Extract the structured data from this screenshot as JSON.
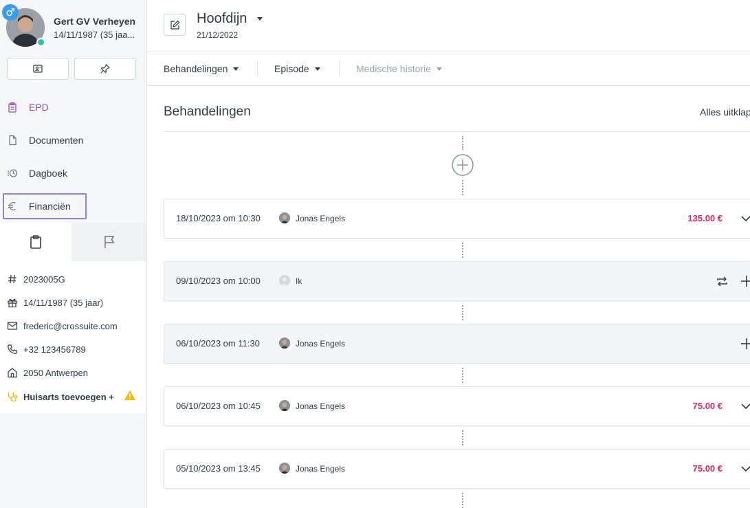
{
  "patient": {
    "name": "Gert GV Verheyen",
    "dob_short": "14/11/1987 (35 jaa...",
    "gender_symbol": "♂"
  },
  "sidebar": {
    "nav": [
      {
        "label": "EPD",
        "icon": "clipboard-icon"
      },
      {
        "label": "Documenten",
        "icon": "document-icon"
      },
      {
        "label": "Dagboek",
        "icon": "history-icon"
      },
      {
        "label": "Financiën",
        "icon": "euro-icon"
      }
    ],
    "info": {
      "id": "2023005G",
      "birthday": "14/11/1987 (35 jaar)",
      "email": "frederic@crossuite.com",
      "phone": "+32 123456789",
      "address": "2050 Antwerpen",
      "gp": "Huisarts toevoegen +"
    }
  },
  "header": {
    "title": "Hoofdijn",
    "date": "21/12/2022"
  },
  "tabs": [
    {
      "label": "Behandelingen"
    },
    {
      "label": "Episode"
    },
    {
      "label": "Medische historie"
    }
  ],
  "section": {
    "title": "Behandelingen",
    "expand_all": "Alles uitklap"
  },
  "treatments": [
    {
      "datetime": "18/10/2023 om 10:30",
      "practitioner": "Jonas Engels",
      "price": "135.00 €"
    },
    {
      "datetime": "09/10/2023 om 10:00",
      "practitioner": "Ik",
      "price": ""
    },
    {
      "datetime": "06/10/2023 om 11:30",
      "practitioner": "Jonas Engels",
      "price": ""
    },
    {
      "datetime": "06/10/2023 om 10:45",
      "practitioner": "Jonas Engels",
      "price": "75.00 €"
    },
    {
      "datetime": "05/10/2023 om 13:45",
      "practitioner": "Jonas Engels",
      "price": "75.00 €"
    }
  ],
  "colors": {
    "accent": "#8a4fb5",
    "selection": "#8b80ea",
    "price": "#e0245e",
    "online": "#2ec5a3",
    "gender": "#3b9ce8",
    "warning": "#f2b807"
  }
}
